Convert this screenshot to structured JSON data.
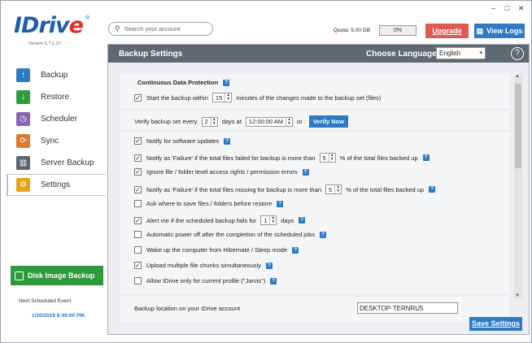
{
  "brand": {
    "logo_text": "IDriv",
    "logo_accent": "e",
    "version": "Version 5.7.1.37"
  },
  "window_controls": [
    "–",
    "□",
    "✕"
  ],
  "search": {
    "placeholder": "Search your account"
  },
  "quota": {
    "label": "Quota: 5.00 GB",
    "percent": "0%",
    "used_fraction": 0
  },
  "buttons": {
    "upgrade": "Upgrade",
    "view_logs": "View Logs",
    "verify_now": "Verify Now",
    "save_settings": "Save Settings",
    "disk_image_backup": "Disk Image Backup"
  },
  "sidebar": {
    "items": [
      {
        "label": "Backup",
        "icon": "upload-arrow-icon",
        "color": "#2e7bc4"
      },
      {
        "label": "Restore",
        "icon": "download-arrow-icon",
        "color": "#2e9a3c"
      },
      {
        "label": "Scheduler",
        "icon": "clock-icon",
        "color": "#8a63b8"
      },
      {
        "label": "Sync",
        "icon": "sync-icon",
        "color": "#e07a2e"
      },
      {
        "label": "Server Backup",
        "icon": "server-icon",
        "color": "#5a6470"
      },
      {
        "label": "Settings",
        "icon": "gear-icon",
        "color": "#e6a21a"
      }
    ],
    "active_index": 5
  },
  "next_event": {
    "label": "Next Scheduled Event",
    "value": "1/30/2019 8:49:00 PM"
  },
  "panel": {
    "title": "Backup Settings",
    "language_label": "Choose Language",
    "language": "English"
  },
  "cdp": {
    "heading": "Continuous Data Protection",
    "start_pre": "Start the backup within",
    "minutes": "15",
    "start_post": "minutes of the changes made to the backup set (files)",
    "checked": true
  },
  "verify": {
    "pre": "Verify backup set every",
    "days": "2",
    "mid": "days at",
    "time": "12:00:00 AM",
    "or": "or"
  },
  "options": [
    {
      "label": "Notify for software updates",
      "checked": true
    },
    {
      "label": "Notify as 'Failure' if the total files failed for backup is more than",
      "value": "5",
      "suffix": "% of the total files backed up",
      "checked": true
    },
    {
      "label": "Ignore file / folder level access rights / permission errors",
      "checked": true
    },
    {
      "label": "Notify as 'Failure' if the total files missing for backup is more than",
      "value": "5",
      "suffix": "% of the total files backed up",
      "checked": true
    },
    {
      "label": "Ask where to save files / folders before restore",
      "checked": false
    },
    {
      "label": "Alert me if the scheduled backup fails for",
      "value": "1",
      "suffix": "days",
      "checked": true
    },
    {
      "label": "Automatic power off after the completion of the scheduled jobs",
      "checked": false
    },
    {
      "label": "Wake up the computer from Hibernate / Sleep mode",
      "checked": false
    },
    {
      "label": "Upload multiple file chunks simultaneously",
      "checked": true
    },
    {
      "label": "Allow IDrive only for current profile (\"Jarvis\")",
      "checked": false
    }
  ],
  "location": {
    "label": "Backup location on your IDrive account",
    "value": "DESKTOP-TERNRU5"
  },
  "colors": {
    "accent": "#2e7bc4",
    "upgrade": "#e05a55",
    "disk": "#2e9a3c",
    "header": "#5f6972"
  }
}
